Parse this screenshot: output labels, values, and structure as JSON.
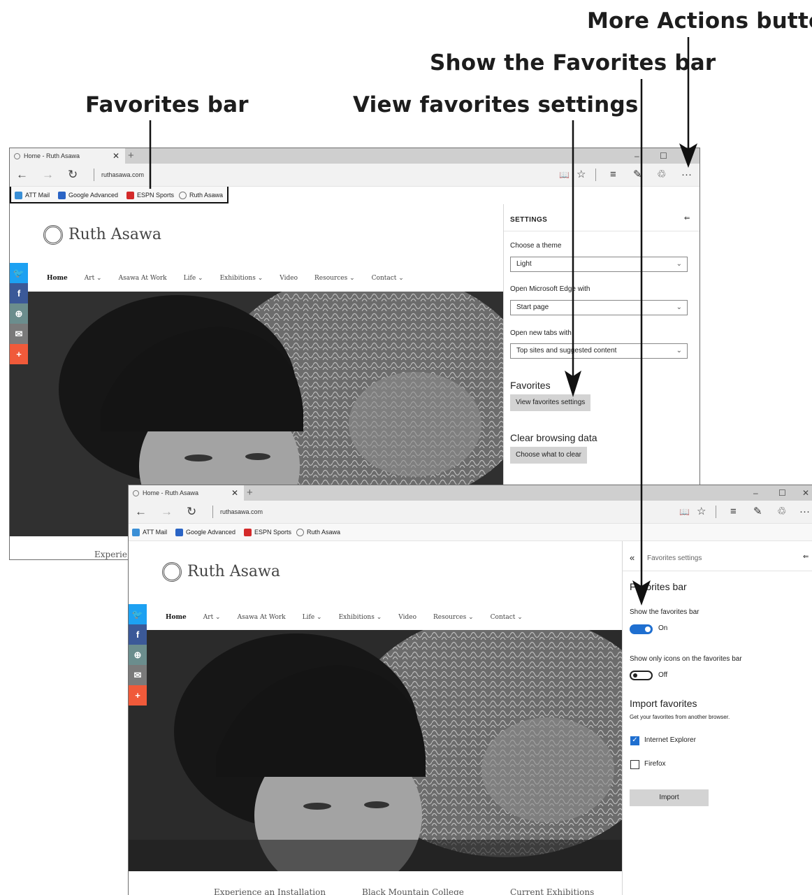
{
  "callouts": {
    "more_actions": "More Actions button",
    "show_favorites_bar": "Show the Favorites bar",
    "favorites_bar": "Favorites bar",
    "view_favorites_settings": "View favorites settings"
  },
  "browser": {
    "tab_title": "Home - Ruth Asawa",
    "tab_close": "✕",
    "new_tab": "+",
    "url": "ruthasawa.com",
    "window_controls": {
      "minimize": "–",
      "maximize": "☐",
      "close": "✕"
    },
    "nav": {
      "back": "←",
      "forward": "→",
      "refresh": "↻"
    },
    "toolbar": {
      "reading_view": "📖",
      "favorite_star": "☆",
      "hub": "≡",
      "web_note": "✎",
      "share": "♲",
      "more_actions": "···"
    },
    "favorites": [
      "ATT Mail",
      "Google Advanced",
      "ESPN Sports",
      "Ruth Asawa"
    ]
  },
  "site": {
    "logo_text": "Ruth Asawa",
    "nav_items": [
      "Home",
      "Art ⌄",
      "Asawa At Work",
      "Life ⌄",
      "Exhibitions ⌄",
      "Video",
      "Resources ⌄",
      "Contact ⌄"
    ],
    "social": [
      "🐦",
      "f",
      "⊕",
      "✉",
      "+"
    ],
    "social_colors": [
      "#1da1f2",
      "#3b5998",
      "#6b8d8d",
      "#7a7a7a",
      "#f05a3a"
    ],
    "bottom_partial": "Experie",
    "bottom_links": [
      "Experience an Installation",
      "Black Mountain College",
      "Current Exhibitions"
    ]
  },
  "settings": {
    "header": "SETTINGS",
    "pin": "⇐",
    "theme_label": "Choose a theme",
    "theme_value": "Light",
    "open_with_label": "Open Microsoft Edge with",
    "open_with_value": "Start page",
    "new_tabs_label": "Open new tabs with",
    "new_tabs_value": "Top sites and suggested content",
    "favorites_heading": "Favorites",
    "view_favorites_button": "View favorites settings",
    "clear_heading": "Clear browsing data",
    "clear_button": "Choose what to clear",
    "chevron": "⌄"
  },
  "fav_settings": {
    "back": "«",
    "header": "Favorites settings",
    "pin": "⇐",
    "bar_heading": "Favorites bar",
    "show_bar_label": "Show the favorites bar",
    "show_bar_state": "On",
    "icons_only_label": "Show only icons on the favorites bar",
    "icons_only_state": "Off",
    "import_heading": "Import favorites",
    "import_sub": "Get your favorites from another browser.",
    "ie_label": "Internet Explorer",
    "firefox_label": "Firefox",
    "import_button": "Import",
    "check": "✓"
  }
}
